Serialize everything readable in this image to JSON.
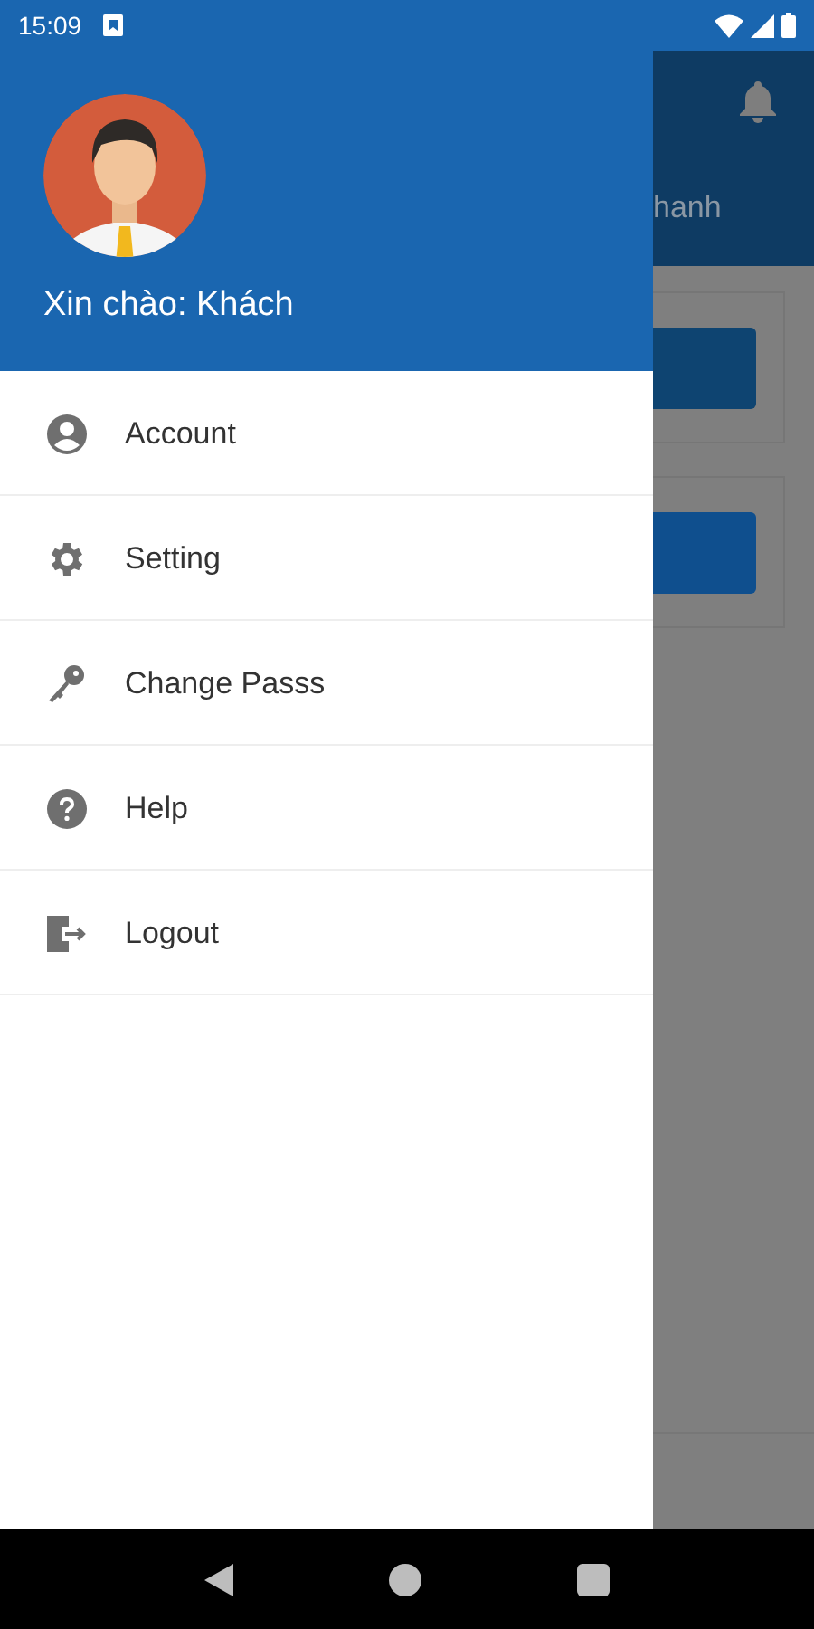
{
  "status_bar": {
    "time": "15:09"
  },
  "drawer": {
    "greeting": "Xin chào: Khách",
    "items": [
      {
        "label": "Account",
        "kind": "account"
      },
      {
        "label": "Setting",
        "kind": "settings"
      },
      {
        "label": "Change Passs",
        "kind": "key"
      },
      {
        "label": "Help",
        "kind": "help"
      },
      {
        "label": "Logout",
        "kind": "logout"
      }
    ]
  },
  "background_screen": {
    "tab_fragment": "hanh"
  }
}
